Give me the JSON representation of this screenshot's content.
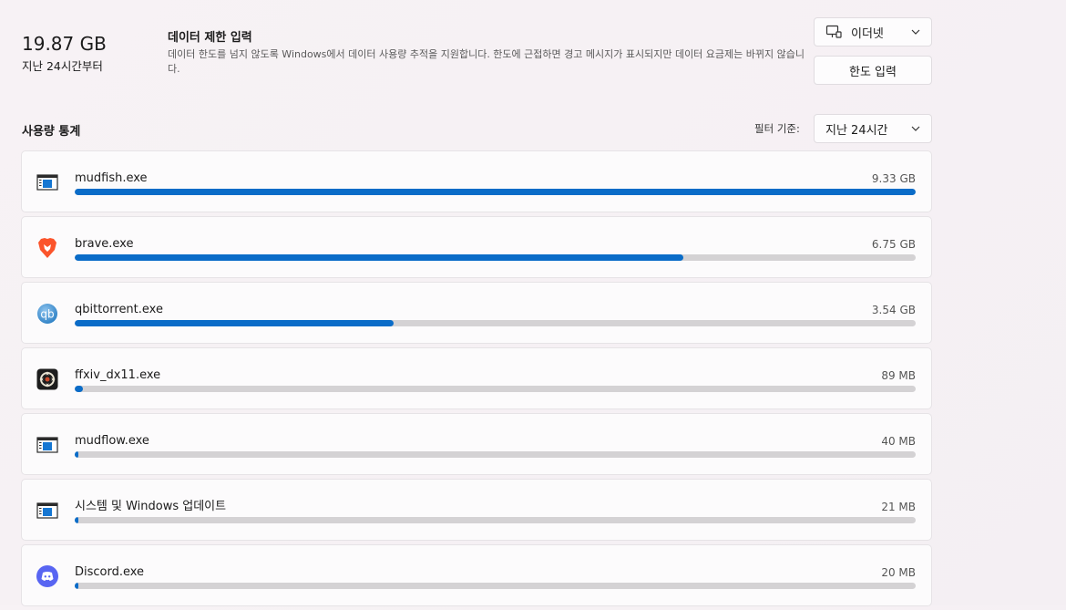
{
  "summary": {
    "total": "19.87 GB",
    "period": "지난 24시간부터"
  },
  "data_limit": {
    "title": "데이터 제한 입력",
    "description": "데이터 한도를 넘지 않도록 Windows에서 데이터 사용량 추적을 지원합니다. 한도에 근접하면 경고 메시지가 표시되지만 데이터 요금제는 바뀌지 않습니다."
  },
  "network_select": {
    "label": "이더넷",
    "icon": "ethernet-icon"
  },
  "enter_limit_button": "한도 입력",
  "usage_section": {
    "title": "사용량 통계",
    "filter_label": "필터 기준:",
    "filter_value": "지난 24시간"
  },
  "colors": {
    "accent": "#0a6cc8",
    "track": "#d4d2d4"
  },
  "apps": [
    {
      "name": "mudfish.exe",
      "usage": "9.33 GB",
      "fraction": 1.0,
      "icon": "generic-app-icon"
    },
    {
      "name": "brave.exe",
      "usage": "6.75 GB",
      "fraction": 0.7235,
      "icon": "brave-icon"
    },
    {
      "name": "qbittorrent.exe",
      "usage": "3.54 GB",
      "fraction": 0.3794,
      "icon": "qbittorrent-icon"
    },
    {
      "name": "ffxiv_dx11.exe",
      "usage": "89 MB",
      "fraction": 0.0093,
      "icon": "ffxiv-icon"
    },
    {
      "name": "mudflow.exe",
      "usage": "40 MB",
      "fraction": 0.0042,
      "icon": "generic-app-icon"
    },
    {
      "name": "시스템 및 Windows 업데이트",
      "usage": "21 MB",
      "fraction": 0.0022,
      "icon": "generic-app-icon"
    },
    {
      "name": "Discord.exe",
      "usage": "20 MB",
      "fraction": 0.0021,
      "icon": "discord-icon"
    }
  ]
}
